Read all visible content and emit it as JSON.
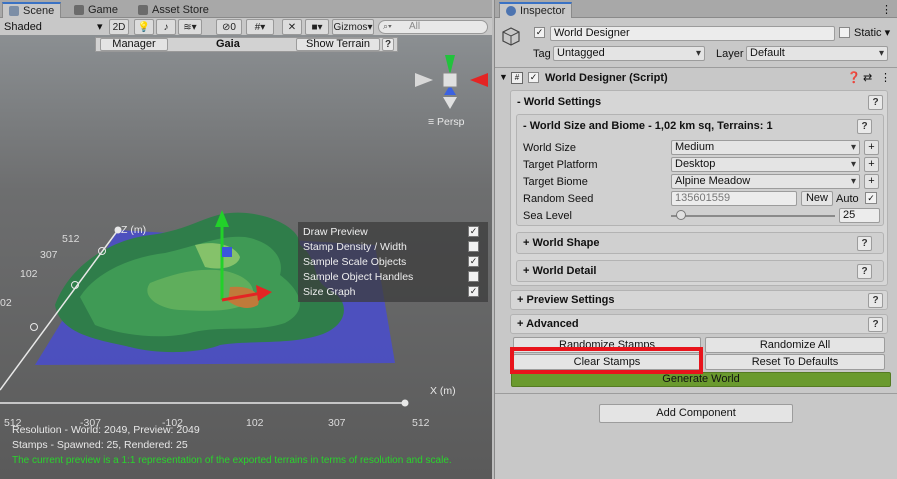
{
  "tabs": {
    "scene": "Scene",
    "game": "Game",
    "asset_store": "Asset Store",
    "inspector": "Inspector"
  },
  "scene_toolbar": {
    "shading": "Shaded",
    "mode_2d": "2D",
    "hidden_count": "0",
    "gizmos": "Gizmos",
    "search_placeholder": "All"
  },
  "gaia_bar": {
    "manager": "Manager",
    "title": "Gaia",
    "show_terrain": "Show Terrain",
    "help": "?"
  },
  "scene": {
    "persp": "Persp",
    "axis_z": "Z (m)",
    "axis_x": "X (m)",
    "z_ticks": [
      "512",
      "307",
      "102",
      "02"
    ],
    "x_ticks": [
      "512",
      "-307",
      "-102",
      "102",
      "307",
      "512"
    ],
    "overlay": [
      {
        "label": "Draw Preview",
        "checked": true
      },
      {
        "label": "Stamp Density / Width",
        "checked": false
      },
      {
        "label": "Sample Scale Objects",
        "checked": true
      },
      {
        "label": "Sample Object Handles",
        "checked": false
      },
      {
        "label": "Size Graph",
        "checked": true
      }
    ],
    "status_resolution": "Resolution - World: 2049, Preview: 2049",
    "status_stamps": "Stamps - Spawned: 25, Rendered: 25",
    "status_note": "The current preview is a 1:1 representation of the exported terrains in terms of resolution and scale."
  },
  "inspector": {
    "object_name": "World Designer",
    "static_label": "Static",
    "tag_label": "Tag",
    "tag_value": "Untagged",
    "layer_label": "Layer",
    "layer_value": "Default",
    "component_title": "World Designer (Script)",
    "world_settings": "- World Settings",
    "world_size_biome": "-  World Size and Biome - 1,02 km sq, Terrains: 1",
    "world_size_label": "World Size",
    "world_size_value": "Medium",
    "target_platform_label": "Target Platform",
    "target_platform_value": "Desktop",
    "target_biome_label": "Target Biome",
    "target_biome_value": "Alpine Meadow",
    "random_seed_label": "Random Seed",
    "random_seed_value": "135601559",
    "new_label": "New",
    "auto_label": "Auto",
    "sea_level_label": "Sea Level",
    "sea_level_value": "25",
    "sea_level_fraction": 0.06,
    "world_shape": "+  World Shape",
    "world_detail": "+  World Detail",
    "preview_settings": "+ Preview Settings",
    "advanced": "+ Advanced",
    "randomize_stamps": "Randomize Stamps",
    "randomize_all": "Randomize All",
    "clear_stamps": "Clear Stamps",
    "reset_defaults": "Reset To Defaults",
    "generate_world": "Generate World",
    "add_component": "Add Component",
    "help": "?"
  },
  "colors": {
    "generate_green": "#6a9a2e",
    "highlight_red": "#e8141c",
    "status_green": "#29d42c"
  }
}
